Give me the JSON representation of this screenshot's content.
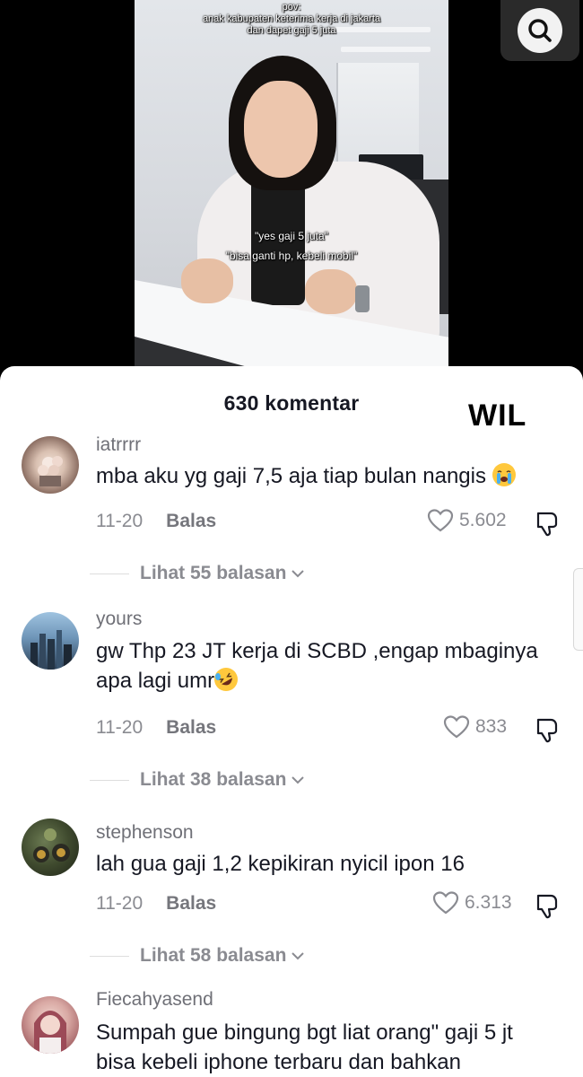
{
  "video": {
    "caption_line1": "pov:",
    "caption_line2": "anak kabupaten keterima kerja di jakarta",
    "caption_line3": "dan dapet gaji 5 juta",
    "quote1": "\"yes gaji 5 juta\"",
    "quote2": "\"bisa ganti hp, kebeli mobil\""
  },
  "header": {
    "search_icon": "search-icon"
  },
  "sheet": {
    "title": "630 komentar",
    "watermark": "WIL"
  },
  "comments": [
    {
      "username": "iatrrrr",
      "text": "mba aku yg gaji 7,5 aja tiap bulan nangis",
      "emoji": "loudly-crying-face",
      "date": "11-20",
      "reply_label": "Balas",
      "likes": "5.602",
      "view_replies": "Lihat 55 balasan"
    },
    {
      "username": "yours",
      "text": "gw Thp 23 JT kerja di SCBD ,engap mbaginya apa lagi umr",
      "emoji": "rolling-on-floor-laughing",
      "date": "11-20",
      "reply_label": "Balas",
      "likes": "833",
      "view_replies": "Lihat 38 balasan"
    },
    {
      "username": "stephenson",
      "text": "lah gua gaji 1,2 kepikiran nyicil ipon 16",
      "date": "11-20",
      "reply_label": "Balas",
      "likes": "6.313",
      "view_replies": "Lihat 58 balasan"
    },
    {
      "username": "Fiecahyasend",
      "text": "Sumpah gue bingung bgt liat orang\" gaji 5 jt bisa kebeli iphone terbaru dan bahkan"
    }
  ],
  "colors": {
    "background": "#000000",
    "sheet": "#ffffff",
    "text_primary": "#161823",
    "text_secondary": "#8a8b91"
  }
}
